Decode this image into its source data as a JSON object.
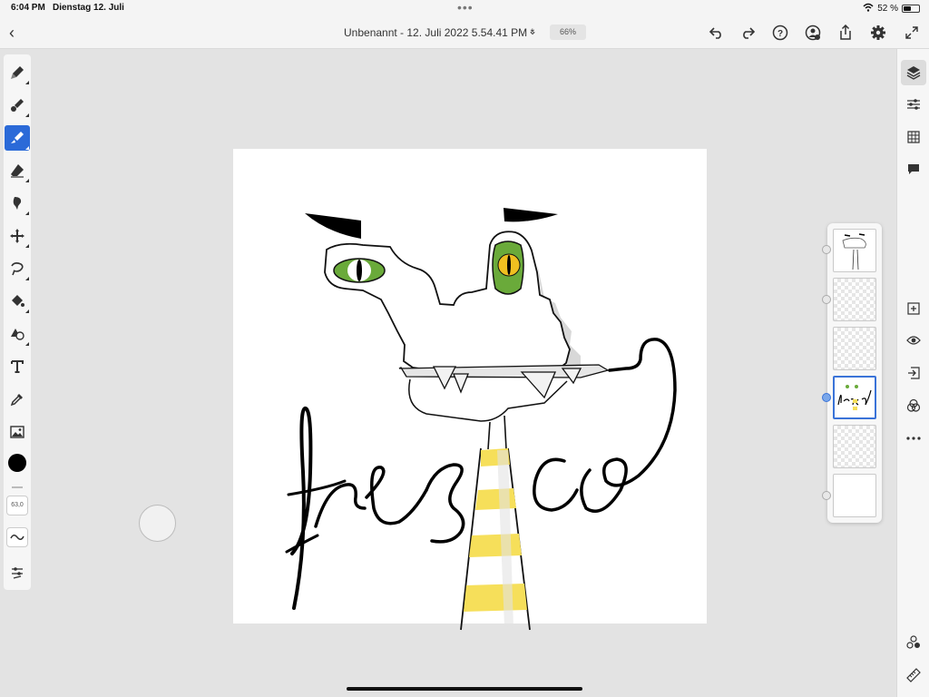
{
  "status_bar": {
    "time": "6:04 PM",
    "date": "Dienstag 12. Juli",
    "battery": "52 %",
    "battery_level": 0.52
  },
  "title_bar": {
    "document_title": "Unbenannt - 12. Juli 2022 5.54.41 PM *",
    "zoom": "66%"
  },
  "left_toolbar": {
    "tools": [
      {
        "name": "pixel-brush",
        "icon": "pixel-brush-icon"
      },
      {
        "name": "live-brush",
        "icon": "live-brush-icon"
      },
      {
        "name": "vector-brush",
        "icon": "vector-brush-icon",
        "active": true
      },
      {
        "name": "eraser",
        "icon": "eraser-icon"
      },
      {
        "name": "smudge",
        "icon": "smudge-icon"
      },
      {
        "name": "move",
        "icon": "move-icon"
      },
      {
        "name": "selection",
        "icon": "lasso-icon"
      },
      {
        "name": "fill",
        "icon": "fill-bucket-icon"
      },
      {
        "name": "shapes",
        "icon": "shapes-icon"
      },
      {
        "name": "text",
        "icon": "text-icon"
      },
      {
        "name": "eyedropper",
        "icon": "eyedropper-icon"
      },
      {
        "name": "place-image",
        "icon": "image-icon"
      }
    ],
    "color": "#000000",
    "brush_size": "63,0"
  },
  "right_toolbar": {
    "top_tools": [
      "layers-icon",
      "adjustments-icon",
      "grid-icon",
      "comments-icon"
    ],
    "layer_actions": [
      "add-layer-icon",
      "visibility-icon",
      "merge-down-icon",
      "blend-mode-icon",
      "more-icon"
    ],
    "bottom_tools": [
      "shapes-library-icon",
      "ruler-icon"
    ]
  },
  "layers_panel": {
    "layers": [
      {
        "type": "artwork",
        "selected": false
      },
      {
        "type": "empty",
        "selected": false
      },
      {
        "type": "empty",
        "selected": false
      },
      {
        "type": "artwork-text",
        "selected": true
      },
      {
        "type": "empty",
        "selected": false
      },
      {
        "type": "background",
        "selected": false
      }
    ]
  },
  "colors": {
    "accent": "#2b6ad8",
    "eye_green": "#6aaa3a",
    "stripe_yellow": "#f6df5a"
  }
}
